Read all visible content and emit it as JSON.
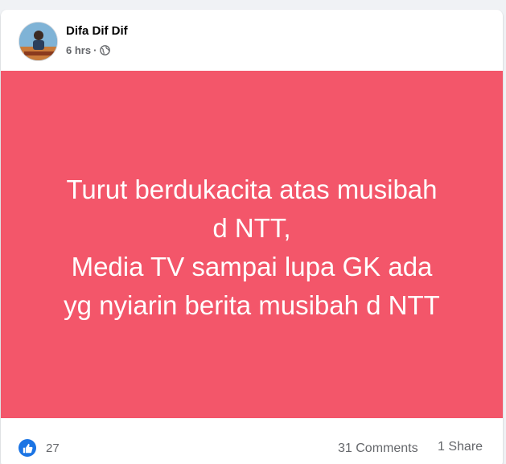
{
  "post": {
    "author": "Difa Dif Dif",
    "time": "6 hrs",
    "separator": "·",
    "privacy_icon": "globe-icon",
    "background_color": "#f3566a",
    "text": "Turut berdukacita atas musibah\nd NTT,\nMedia TV sampai lupa GK ada\nyg nyiarin berita musibah d NTT",
    "reactions": {
      "icon": "like-icon",
      "color": "#1b74e4",
      "count": "27"
    },
    "comments": "31 Comments",
    "shares": "1 Share"
  }
}
